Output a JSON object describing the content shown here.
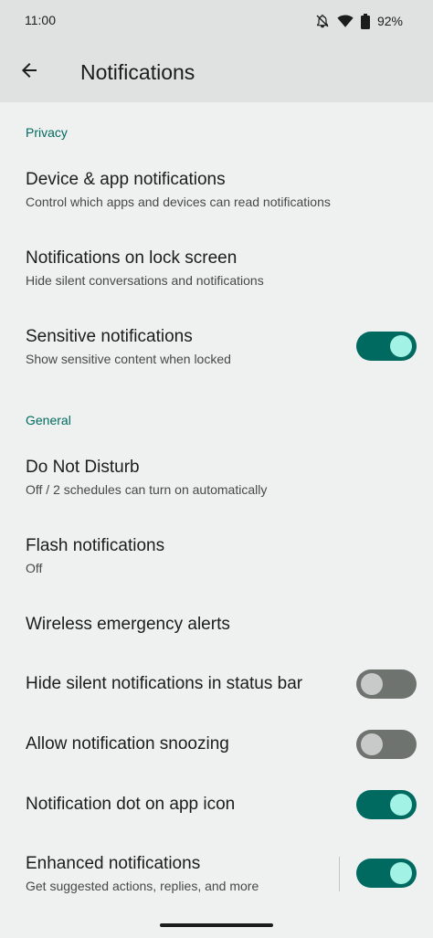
{
  "status_bar": {
    "time": "11:00",
    "battery": "92%",
    "icons": [
      "notifications-off-icon",
      "wifi-icon",
      "battery-icon"
    ]
  },
  "app_bar": {
    "title": "Notifications",
    "back_icon": "arrow-back-icon"
  },
  "sections": {
    "privacy": "Privacy",
    "general": "General"
  },
  "items": {
    "device_app": {
      "title": "Device & app notifications",
      "subtitle": "Control which apps and devices can read notifications"
    },
    "lock_screen": {
      "title": "Notifications on lock screen",
      "subtitle": "Hide silent conversations and notifications"
    },
    "sensitive": {
      "title": "Sensitive notifications",
      "subtitle": "Show sensitive content when locked",
      "toggle": "on"
    },
    "dnd": {
      "title": "Do Not Disturb",
      "subtitle": "Off / 2 schedules can turn on automatically"
    },
    "flash": {
      "title": "Flash notifications",
      "subtitle": "Off"
    },
    "emergency": {
      "title": "Wireless emergency alerts"
    },
    "hide_silent": {
      "title": "Hide silent notifications in status bar",
      "toggle": "off"
    },
    "snoozing": {
      "title": "Allow notification snoozing",
      "toggle": "off"
    },
    "dot": {
      "title": "Notification dot on app icon",
      "toggle": "on"
    },
    "enhanced": {
      "title": "Enhanced notifications",
      "subtitle": "Get suggested actions, replies, and more",
      "toggle": "on"
    }
  },
  "colors": {
    "accent": "#006a60",
    "thumb_on": "#a3f2e6",
    "track_off": "#6e7370",
    "background": "#eff1f0",
    "app_bar": "#e0e2e1"
  }
}
